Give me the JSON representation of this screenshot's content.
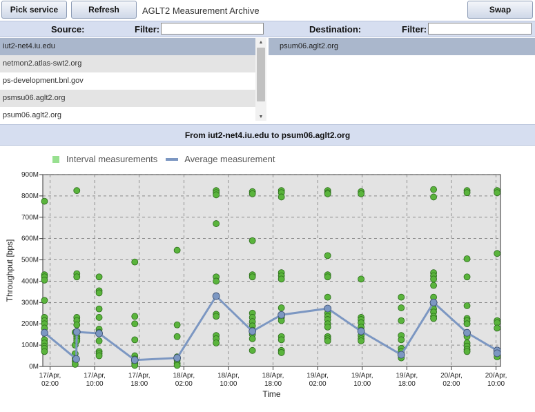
{
  "toolbar": {
    "pick_service_label": "Pick service",
    "refresh_label": "Refresh",
    "app_title": "AGLT2 Measurement Archive",
    "swap_label": "Swap"
  },
  "filters": {
    "source_label": "Source:",
    "source_filter_label": "Filter:",
    "source_filter_value": "",
    "destination_label": "Destination:",
    "destination_filter_label": "Filter:",
    "destination_filter_value": ""
  },
  "source_hosts": [
    "iut2-net4.iu.edu",
    "netmon2.atlas-swt2.org",
    "ps-development.bnl.gov",
    "psmsu06.aglt2.org",
    "psum06.aglt2.org"
  ],
  "destination_hosts": [
    "psum06.aglt2.org"
  ],
  "route_label": "From iut2-net4.iu.edu to psum06.aglt2.org",
  "legend": {
    "interval": "Interval measurements",
    "average": "Average measurement"
  },
  "colors": {
    "interval": "#5ab43c",
    "interval_legend": "#98e090",
    "average": "#7c97c2",
    "plot_bg": "#e3e3e3",
    "header_bg": "#d6def0"
  },
  "chart_data": {
    "type": "scatter",
    "xlabel": "Time",
    "ylabel": "Throughput [bps]",
    "ylim": [
      0,
      900
    ],
    "y_ticks": [
      "0M",
      "100M",
      "200M",
      "300M",
      "400M",
      "500M",
      "600M",
      "700M",
      "800M",
      "900M"
    ],
    "x_tick_labels": [
      [
        "17/Apr,",
        "02:00"
      ],
      [
        "17/Apr,",
        "10:00"
      ],
      [
        "17/Apr,",
        "18:00"
      ],
      [
        "18/Apr,",
        "02:00"
      ],
      [
        "18/Apr,",
        "10:00"
      ],
      [
        "18/Apr,",
        "18:00"
      ],
      [
        "19/Apr,",
        "02:00"
      ],
      [
        "19/Apr,",
        "10:00"
      ],
      [
        "19/Apr,",
        "18:00"
      ],
      [
        "20/Apr,",
        "02:00"
      ],
      [
        "20/Apr,",
        "10:00"
      ]
    ],
    "x_range_hours": [
      -1.3,
      80.8
    ],
    "grid": true,
    "legend_position": "top-left",
    "series": [
      {
        "name": "Interval measurements",
        "points": [
          [
            -1,
            775
          ],
          [
            -1,
            430
          ],
          [
            -1,
            420
          ],
          [
            -1,
            405
          ],
          [
            -1,
            310
          ],
          [
            -1,
            230
          ],
          [
            -1,
            215
          ],
          [
            -1,
            200
          ],
          [
            -1,
            180
          ],
          [
            -1,
            125
          ],
          [
            -1,
            110
          ],
          [
            -1,
            95
          ],
          [
            -1,
            85
          ],
          [
            -1,
            70
          ],
          [
            4.5,
            60
          ],
          [
            4.5,
            40
          ],
          [
            4.5,
            25
          ],
          [
            4.5,
            10
          ],
          [
            4.5,
            160
          ],
          [
            4.5,
            100
          ],
          [
            4.8,
            825
          ],
          [
            4.8,
            435
          ],
          [
            4.8,
            420
          ],
          [
            4.8,
            230
          ],
          [
            4.8,
            215
          ],
          [
            4.8,
            195
          ],
          [
            4.8,
            160
          ],
          [
            4.8,
            140
          ],
          [
            4.8,
            130
          ],
          [
            4.8,
            120
          ],
          [
            8.8,
            420
          ],
          [
            8.8,
            355
          ],
          [
            8.8,
            345
          ],
          [
            8.8,
            270
          ],
          [
            8.8,
            230
          ],
          [
            8.8,
            175
          ],
          [
            8.8,
            160
          ],
          [
            8.8,
            120
          ],
          [
            8.8,
            70
          ],
          [
            8.8,
            60
          ],
          [
            8.8,
            50
          ],
          [
            15.2,
            490
          ],
          [
            15.2,
            235
          ],
          [
            15.2,
            200
          ],
          [
            15.2,
            125
          ],
          [
            15.2,
            50
          ],
          [
            15.2,
            35
          ],
          [
            15.2,
            25
          ],
          [
            15.2,
            15
          ],
          [
            15.2,
            5
          ],
          [
            22.8,
            545
          ],
          [
            22.8,
            195
          ],
          [
            22.8,
            140
          ],
          [
            22.8,
            45
          ],
          [
            22.8,
            30
          ],
          [
            22.8,
            15
          ],
          [
            22.8,
            5
          ],
          [
            29.8,
            825
          ],
          [
            29.8,
            815
          ],
          [
            29.8,
            805
          ],
          [
            29.8,
            670
          ],
          [
            29.8,
            420
          ],
          [
            29.8,
            400
          ],
          [
            29.8,
            245
          ],
          [
            29.8,
            235
          ],
          [
            29.8,
            145
          ],
          [
            29.8,
            130
          ],
          [
            29.8,
            110
          ],
          [
            36.3,
            820
          ],
          [
            36.3,
            810
          ],
          [
            36.3,
            590
          ],
          [
            36.3,
            430
          ],
          [
            36.3,
            420
          ],
          [
            36.3,
            250
          ],
          [
            36.3,
            230
          ],
          [
            36.3,
            210
          ],
          [
            36.3,
            190
          ],
          [
            36.3,
            170
          ],
          [
            36.3,
            150
          ],
          [
            36.3,
            130
          ],
          [
            36.3,
            75
          ],
          [
            41.5,
            825
          ],
          [
            41.5,
            815
          ],
          [
            41.5,
            795
          ],
          [
            41.5,
            440
          ],
          [
            41.5,
            425
          ],
          [
            41.5,
            410
          ],
          [
            41.5,
            275
          ],
          [
            41.5,
            230
          ],
          [
            41.5,
            215
          ],
          [
            41.5,
            140
          ],
          [
            41.5,
            125
          ],
          [
            41.5,
            75
          ],
          [
            41.5,
            65
          ],
          [
            49.8,
            825
          ],
          [
            49.8,
            815
          ],
          [
            49.8,
            810
          ],
          [
            49.8,
            520
          ],
          [
            49.8,
            430
          ],
          [
            49.8,
            420
          ],
          [
            49.8,
            325
          ],
          [
            49.8,
            250
          ],
          [
            49.8,
            235
          ],
          [
            49.8,
            220
          ],
          [
            49.8,
            200
          ],
          [
            49.8,
            185
          ],
          [
            49.8,
            140
          ],
          [
            49.8,
            130
          ],
          [
            49.8,
            120
          ],
          [
            55.8,
            820
          ],
          [
            55.8,
            810
          ],
          [
            55.8,
            410
          ],
          [
            55.8,
            230
          ],
          [
            55.8,
            220
          ],
          [
            55.8,
            205
          ],
          [
            55.8,
            185
          ],
          [
            55.8,
            170
          ],
          [
            55.8,
            145
          ],
          [
            55.8,
            130
          ],
          [
            55.8,
            120
          ],
          [
            63.0,
            325
          ],
          [
            63.0,
            275
          ],
          [
            63.0,
            215
          ],
          [
            63.0,
            145
          ],
          [
            63.0,
            125
          ],
          [
            63.0,
            85
          ],
          [
            63.0,
            70
          ],
          [
            63.0,
            55
          ],
          [
            63.0,
            40
          ],
          [
            68.8,
            830
          ],
          [
            68.8,
            795
          ],
          [
            68.8,
            440
          ],
          [
            68.8,
            425
          ],
          [
            68.8,
            410
          ],
          [
            68.8,
            380
          ],
          [
            68.8,
            325
          ],
          [
            68.8,
            290
          ],
          [
            68.8,
            270
          ],
          [
            68.8,
            255
          ],
          [
            68.8,
            235
          ],
          [
            68.8,
            225
          ],
          [
            74.8,
            825
          ],
          [
            74.8,
            815
          ],
          [
            74.8,
            505
          ],
          [
            74.8,
            420
          ],
          [
            74.8,
            285
          ],
          [
            74.8,
            225
          ],
          [
            74.8,
            215
          ],
          [
            74.8,
            200
          ],
          [
            74.8,
            150
          ],
          [
            74.8,
            140
          ],
          [
            74.8,
            110
          ],
          [
            74.8,
            95
          ],
          [
            74.8,
            80
          ],
          [
            74.8,
            70
          ],
          [
            80.2,
            825
          ],
          [
            80.2,
            815
          ],
          [
            80.2,
            530
          ],
          [
            80.2,
            215
          ],
          [
            80.2,
            205
          ],
          [
            80.2,
            180
          ],
          [
            80.2,
            75
          ],
          [
            80.2,
            60
          ],
          [
            80.2,
            45
          ]
        ]
      },
      {
        "name": "Average measurement",
        "points": [
          [
            -1,
            158
          ],
          [
            4.7,
            35
          ],
          [
            4.8,
            162
          ],
          [
            8.8,
            155
          ],
          [
            15.2,
            30
          ],
          [
            22.8,
            40
          ],
          [
            29.8,
            330
          ],
          [
            36.3,
            165
          ],
          [
            41.5,
            242
          ],
          [
            49.8,
            272
          ],
          [
            55.8,
            165
          ],
          [
            63.0,
            55
          ],
          [
            68.8,
            300
          ],
          [
            74.8,
            158
          ],
          [
            80.2,
            75
          ],
          [
            80.2,
            62
          ]
        ]
      }
    ]
  }
}
